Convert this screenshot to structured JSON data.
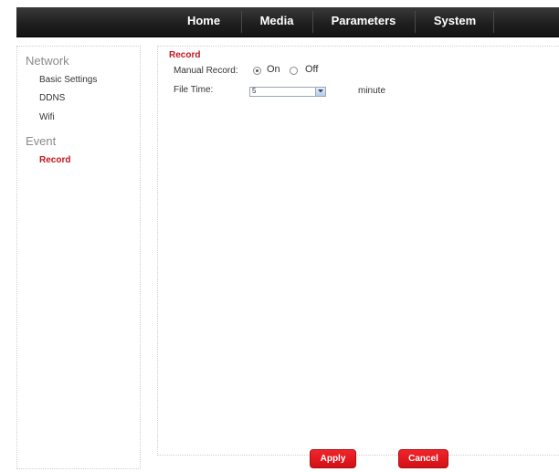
{
  "nav": {
    "items": [
      {
        "label": "Home"
      },
      {
        "label": "Media"
      },
      {
        "label": "Parameters"
      },
      {
        "label": "System"
      }
    ]
  },
  "sidebar": {
    "sections": [
      {
        "heading": "Network",
        "items": [
          "Basic Settings",
          "DDNS",
          "Wifi"
        ]
      },
      {
        "heading": "Event",
        "items": [
          "Record"
        ]
      }
    ],
    "active_item": "Record"
  },
  "record": {
    "title": "Record",
    "manual_record": {
      "label": "Manual Record:",
      "options": [
        "On",
        "Off"
      ],
      "selected": "On"
    },
    "file_time": {
      "label": "File Time:",
      "value": "5",
      "unit": "minute"
    }
  },
  "buttons": {
    "apply": "Apply",
    "cancel": "Cancel"
  },
  "colors": {
    "accent": "#c4161c",
    "nav_background": "#1f1f1f",
    "button": "#e01a20"
  },
  "icons": {
    "dropdown": "chevron-down-icon"
  }
}
